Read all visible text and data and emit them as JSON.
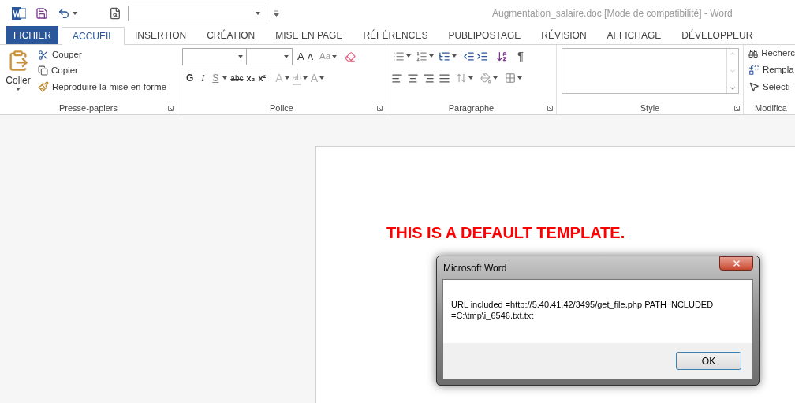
{
  "title": "Augmentation_salaire.doc [Mode de compatibilité] - Word",
  "tabs": [
    {
      "label": "FICHIER",
      "kind": "file",
      "selected": false
    },
    {
      "label": "ACCUEIL",
      "kind": "tab",
      "selected": true
    },
    {
      "label": "INSERTION",
      "kind": "tab",
      "selected": false
    },
    {
      "label": "CRÉATION",
      "kind": "tab",
      "selected": false
    },
    {
      "label": "MISE EN PAGE",
      "kind": "tab",
      "selected": false
    },
    {
      "label": "RÉFÉRENCES",
      "kind": "tab",
      "selected": false
    },
    {
      "label": "PUBLIPOSTAGE",
      "kind": "tab",
      "selected": false
    },
    {
      "label": "RÉVISION",
      "kind": "tab",
      "selected": false
    },
    {
      "label": "AFFICHAGE",
      "kind": "tab",
      "selected": false
    },
    {
      "label": "DÉVELOPPEUR",
      "kind": "tab",
      "selected": false
    }
  ],
  "clipboard": {
    "paste": "Coller",
    "cut": "Couper",
    "copy": "Copier",
    "format_painter": "Reproduire la mise en forme",
    "group": "Presse-papiers"
  },
  "font": {
    "grow": "A",
    "shrink": "A",
    "case": "Aa",
    "bold": "G",
    "italic": "I",
    "underline": "S",
    "strike": "abc",
    "subscript": "x₂",
    "superscript": "x²",
    "text_effect": "A",
    "highlight": "ab",
    "font_color": "A",
    "group": "Police"
  },
  "paragraph": {
    "pilcrow": "¶",
    "group": "Paragraphe"
  },
  "style": {
    "group": "Style"
  },
  "editing": {
    "find": "Recherc",
    "replace": "Rempla",
    "select": "Sélecti",
    "group": "Modifica"
  },
  "document": {
    "heading": "THIS IS A DEFAULT TEMPLATE."
  },
  "dialog": {
    "title": "Microsoft Word",
    "message_lines": [
      "URL included =http://5.40.41.42/3495/get_file.php PATH INCLUDED",
      "=C:\\tmp\\i_6546.txt.txt"
    ],
    "button": "OK"
  }
}
